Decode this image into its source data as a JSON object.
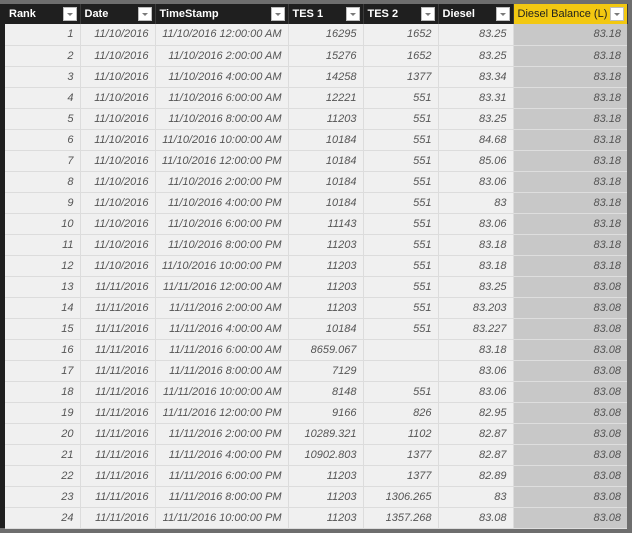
{
  "table": {
    "columns": [
      {
        "key": "rank",
        "label": "Rank"
      },
      {
        "key": "date",
        "label": "Date"
      },
      {
        "key": "timestamp",
        "label": "TimeStamp"
      },
      {
        "key": "tes1",
        "label": "TES 1"
      },
      {
        "key": "tes2",
        "label": "TES 2"
      },
      {
        "key": "diesel",
        "label": "Diesel"
      },
      {
        "key": "diesel_balance",
        "label": "Diesel Balance (L)",
        "selected": true
      }
    ],
    "filter_icon": "dropdown-arrow-icon",
    "accent_color": "#f2c811",
    "rows": [
      [
        "1",
        "11/10/2016",
        "11/10/2016 12:00:00 AM",
        "16295",
        "1652",
        "83.25",
        "83.18"
      ],
      [
        "2",
        "11/10/2016",
        "11/10/2016 2:00:00 AM",
        "15276",
        "1652",
        "83.25",
        "83.18"
      ],
      [
        "3",
        "11/10/2016",
        "11/10/2016 4:00:00 AM",
        "14258",
        "1377",
        "83.34",
        "83.18"
      ],
      [
        "4",
        "11/10/2016",
        "11/10/2016 6:00:00 AM",
        "12221",
        "551",
        "83.31",
        "83.18"
      ],
      [
        "5",
        "11/10/2016",
        "11/10/2016 8:00:00 AM",
        "11203",
        "551",
        "83.25",
        "83.18"
      ],
      [
        "6",
        "11/10/2016",
        "11/10/2016 10:00:00 AM",
        "10184",
        "551",
        "84.68",
        "83.18"
      ],
      [
        "7",
        "11/10/2016",
        "11/10/2016 12:00:00 PM",
        "10184",
        "551",
        "85.06",
        "83.18"
      ],
      [
        "8",
        "11/10/2016",
        "11/10/2016 2:00:00 PM",
        "10184",
        "551",
        "83.06",
        "83.18"
      ],
      [
        "9",
        "11/10/2016",
        "11/10/2016 4:00:00 PM",
        "10184",
        "551",
        "83",
        "83.18"
      ],
      [
        "10",
        "11/10/2016",
        "11/10/2016 6:00:00 PM",
        "11143",
        "551",
        "83.06",
        "83.18"
      ],
      [
        "11",
        "11/10/2016",
        "11/10/2016 8:00:00 PM",
        "11203",
        "551",
        "83.18",
        "83.18"
      ],
      [
        "12",
        "11/10/2016",
        "11/10/2016 10:00:00 PM",
        "11203",
        "551",
        "83.18",
        "83.18"
      ],
      [
        "13",
        "11/11/2016",
        "11/11/2016 12:00:00 AM",
        "11203",
        "551",
        "83.25",
        "83.08"
      ],
      [
        "14",
        "11/11/2016",
        "11/11/2016 2:00:00 AM",
        "11203",
        "551",
        "83.203",
        "83.08"
      ],
      [
        "15",
        "11/11/2016",
        "11/11/2016 4:00:00 AM",
        "10184",
        "551",
        "83.227",
        "83.08"
      ],
      [
        "16",
        "11/11/2016",
        "11/11/2016 6:00:00 AM",
        "8659.067",
        "",
        "83.18",
        "83.08"
      ],
      [
        "17",
        "11/11/2016",
        "11/11/2016 8:00:00 AM",
        "7129",
        "",
        "83.06",
        "83.08"
      ],
      [
        "18",
        "11/11/2016",
        "11/11/2016 10:00:00 AM",
        "8148",
        "551",
        "83.06",
        "83.08"
      ],
      [
        "19",
        "11/11/2016",
        "11/11/2016 12:00:00 PM",
        "9166",
        "826",
        "82.95",
        "83.08"
      ],
      [
        "20",
        "11/11/2016",
        "11/11/2016 2:00:00 PM",
        "10289.321",
        "1102",
        "82.87",
        "83.08"
      ],
      [
        "21",
        "11/11/2016",
        "11/11/2016 4:00:00 PM",
        "10902.803",
        "1377",
        "82.87",
        "83.08"
      ],
      [
        "22",
        "11/11/2016",
        "11/11/2016 6:00:00 PM",
        "11203",
        "1377",
        "82.89",
        "83.08"
      ],
      [
        "23",
        "11/11/2016",
        "11/11/2016 8:00:00 PM",
        "11203",
        "1306.265",
        "83",
        "83.08"
      ],
      [
        "24",
        "11/11/2016",
        "11/11/2016 10:00:00 PM",
        "11203",
        "1357.268",
        "83.08",
        "83.08"
      ]
    ]
  }
}
